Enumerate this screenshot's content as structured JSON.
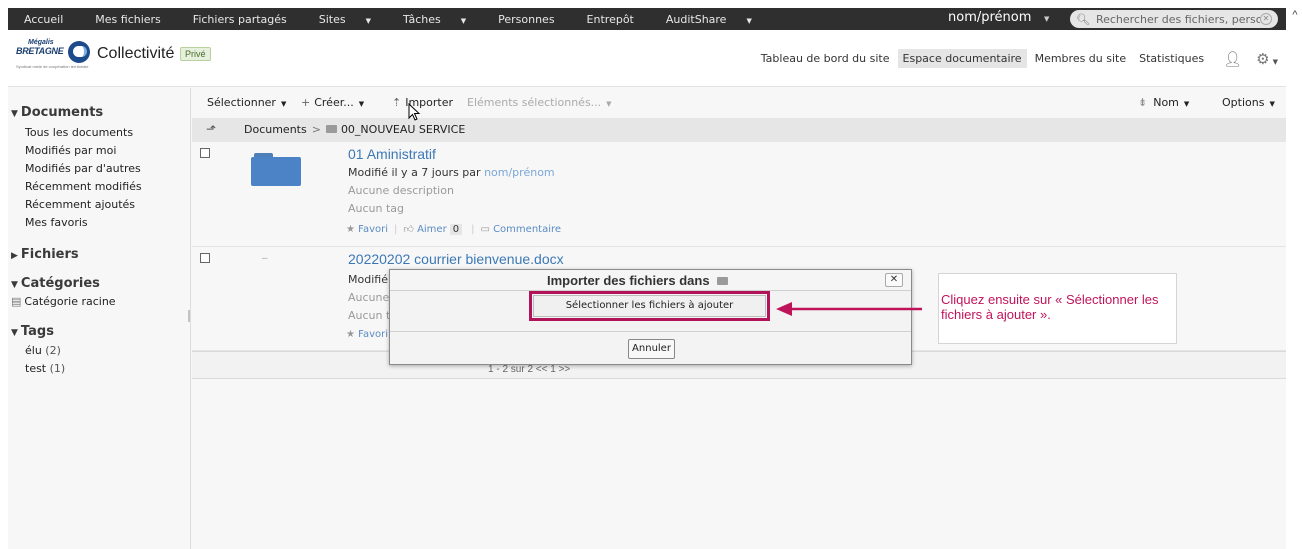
{
  "topbar": {
    "nav": [
      {
        "label": "Accueil",
        "caret": false
      },
      {
        "label": "Mes fichiers",
        "caret": false
      },
      {
        "label": "Fichiers partagés",
        "caret": false
      },
      {
        "label": "Sites",
        "caret": true
      },
      {
        "label": "Tâches",
        "caret": true
      },
      {
        "label": "Personnes",
        "caret": false
      },
      {
        "label": "Entrepôt",
        "caret": false
      },
      {
        "label": "AuditShare",
        "caret": true
      }
    ],
    "user": "nom/prénom",
    "search_placeholder": "Rechercher des fichiers, perso"
  },
  "site": {
    "logo": {
      "line1": "Mégalis",
      "line2": "BRETAGNE",
      "tagline": "Syndicat mixte de coopération territoriale"
    },
    "title": "Collectivité",
    "visibility": "Privé",
    "tabs": [
      {
        "label": "Tableau de bord du site",
        "active": false
      },
      {
        "label": "Espace documentaire",
        "active": true
      },
      {
        "label": "Membres du site",
        "active": false
      },
      {
        "label": "Statistiques",
        "active": false
      }
    ]
  },
  "sidebar": {
    "documents": {
      "heading": "Documents",
      "items": [
        "Tous les documents",
        "Modifiés par moi",
        "Modifiés par d'autres",
        "Récemment modifiés",
        "Récemment ajoutés",
        "Mes favoris"
      ]
    },
    "fichiers": {
      "heading": "Fichiers"
    },
    "categories": {
      "heading": "Catégories",
      "items": [
        "Catégorie racine"
      ]
    },
    "tags": {
      "heading": "Tags",
      "items": [
        {
          "name": "élu",
          "count": "(2)"
        },
        {
          "name": "test",
          "count": "(1)"
        }
      ]
    }
  },
  "toolbar": {
    "select": "Sélectionner",
    "create": "Créer...",
    "import": "Importer",
    "selected_items": "Eléments sélectionnés...",
    "sort": "Nom",
    "options": "Options"
  },
  "breadcrumb": {
    "root": "Documents",
    "separator": ">",
    "current": "00_NOUVEAU SERVICE"
  },
  "rows": [
    {
      "title": "01 Aministratif",
      "modified_prefix": "Modifié il y a 7 jours par",
      "modified_by": "nom/prénom",
      "description": "Aucune description",
      "tag": "Aucun tag",
      "favori": "Favori",
      "aimer": "Aimer",
      "likes": "0",
      "commentaire": "Commentaire"
    },
    {
      "title": "20220202 courrier bienvenue.docx",
      "modified_prefix": "Modifié il",
      "description": "Aucune d",
      "tag": "Aucun ta",
      "favori": "Favori"
    }
  ],
  "pager": "1 - 2 sur 2  <<   1   >>",
  "dialog": {
    "title": "Importer des fichiers dans",
    "close": "✕",
    "select_files_button": "Sélectionner les fichiers à ajouter",
    "cancel_button": "Annuler"
  },
  "annotation": {
    "text": "Cliquez ensuite sur « Sélectionner les fichiers à ajouter ».",
    "color": "#c0145a"
  },
  "colors": {
    "topbar": "#2f2f2f",
    "link": "#3c78b6",
    "highlight": "#b2145a",
    "folder": "#4b83c6"
  }
}
